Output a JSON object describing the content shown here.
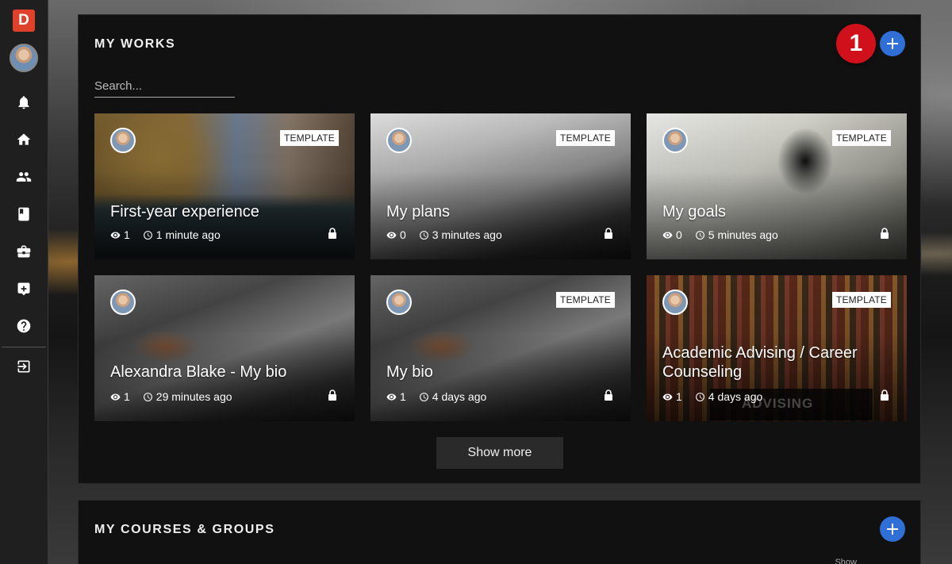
{
  "sidebar": {
    "logo_letter": "D",
    "icons": [
      "bell-icon",
      "home-icon",
      "people-icon",
      "book-icon",
      "briefcase-icon",
      "add-box-icon",
      "help-icon",
      "logout-icon"
    ]
  },
  "works": {
    "title": "MY WORKS",
    "badge": "1",
    "search_placeholder": "Search...",
    "show_more": "Show more",
    "cards": [
      {
        "title": "First-year experience",
        "views": "1",
        "time": "1 minute ago",
        "tag": ""
      },
      {
        "title": "My plans",
        "views": "0",
        "time": "3 minutes ago",
        "tag": "TEMPLATE"
      },
      {
        "title": "My goals",
        "views": "0",
        "time": "5 minutes ago",
        "tag": "TEMPLATE"
      },
      {
        "title": "Alexandra Blake - My bio",
        "views": "1",
        "time": "29 minutes ago",
        "tag": ""
      },
      {
        "title": "My bio",
        "views": "1",
        "time": "4 days ago",
        "tag": "TEMPLATE"
      },
      {
        "title": "Academic Advising / Career Counseling",
        "views": "1",
        "time": "4 days ago",
        "tag": "TEMPLATE",
        "overlay_text": "ADVISING"
      }
    ],
    "card1_tag": "TEMPLATE"
  },
  "courses": {
    "title": "MY COURSES & GROUPS",
    "show_label": "Show"
  }
}
